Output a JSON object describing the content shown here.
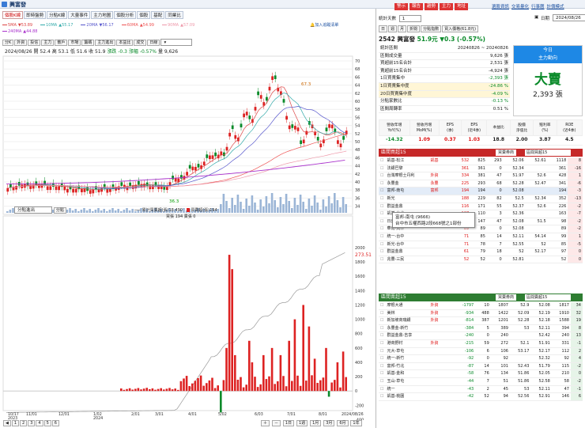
{
  "app": {
    "title": "興富發"
  },
  "top_tabs": [
    {
      "label": "個股K線",
      "active": true
    },
    {
      "label": "即時盤勢"
    },
    {
      "label": "分點K線"
    },
    {
      "label": "大量事件"
    },
    {
      "label": "主力地圖"
    },
    {
      "label": "個股分析"
    },
    {
      "label": "個股"
    },
    {
      "label": "基配"
    },
    {
      "label": "同業比"
    }
  ],
  "ma_legend": [
    {
      "label": "5MA",
      "value": "53.89",
      "dir": "▼",
      "color": "#d44"
    },
    {
      "label": "10MA",
      "value": "55.17",
      "dir": "▲",
      "color": "#3aa"
    },
    {
      "label": "20MA",
      "value": "56.17",
      "dir": "▼",
      "color": "#55c"
    },
    {
      "label": "60MA",
      "value": "54.99",
      "dir": "▲",
      "color": "#e55"
    },
    {
      "label": "90MA",
      "value": "57.09",
      "dir": "▲",
      "color": "#e9a"
    },
    {
      "label": "240MA",
      "value": "44.88",
      "dir": "▲",
      "color": "#a3c"
    }
  ],
  "mini_link": "加入追蹤清單",
  "chart_tabs": [
    "分K",
    "外資",
    "投信",
    "主力",
    "散戶",
    "市場",
    "籌碼",
    "主力進出",
    "本益比",
    "成交",
    "日線"
  ],
  "ohlc": {
    "date": "2024/08/26",
    "open": "開 52.4",
    "high": "高 53.1",
    "low": "低 51.6",
    "close": "收 51.9",
    "change": "漲跌 -0.3",
    "pct": "漲幅 -0.57%",
    "vol": "量 9,626"
  },
  "annotations": {
    "high": "67.3",
    "low": "36.3"
  },
  "price_axis": [
    "70",
    "68",
    "66",
    "64",
    "62",
    "60",
    "58",
    "56",
    "54",
    "52",
    "50",
    "48",
    "46",
    "44",
    "42",
    "40",
    "38",
    "36",
    "34"
  ],
  "lower_panel": {
    "select": "分點進出",
    "btn": "分點",
    "legend_line": "累計買賣超(張)18,490",
    "legend_bar": "買賣超(張)194",
    "legend2": "買張 194  賣張 0",
    "last_val": "273.51",
    "axis": [
      "2000",
      "1800",
      "1600",
      "1400",
      "1200",
      "1000",
      "800",
      "600",
      "400",
      "200",
      "0",
      "-200",
      "-400"
    ]
  },
  "x_dates": [
    "10/17\n2023",
    "11/01",
    "12/01",
    "1/02\n2024",
    "2/01",
    "3/01",
    "4/01",
    "5/02",
    "6/03",
    "7/01",
    "8/01",
    "2024/08/26"
  ],
  "pages": [
    "1",
    "2",
    "3",
    "4",
    "5",
    "6"
  ],
  "right_buttons": [
    "警示",
    "報告",
    "趨勢",
    "主力",
    "地址"
  ],
  "right_links": [
    "選股資訊",
    "交易量化",
    "行事曆",
    "計價模式"
  ],
  "days_label": "統計天數",
  "days_value": "1",
  "mode_buttons": [
    "日",
    "週",
    "月",
    "折閱",
    "分點指數",
    "買入價格(61.8元)"
  ],
  "date_label": "日期",
  "date_value": "2024/08/26",
  "stock": {
    "code_name": "2542 興富發",
    "price": "51.9元",
    "chg": "▼0.3 (-0.57%)"
  },
  "stats": [
    {
      "k": "統計區間",
      "v": "20240826 ~ 20240826"
    },
    {
      "k": "區間成交量",
      "v": "9,626 張"
    },
    {
      "k": "買超前15名合計",
      "v": "2,531 張"
    },
    {
      "k": "賣超前15名合計",
      "v": "-4,924 張"
    },
    {
      "k": "1日買賣集中",
      "v": "-2,393 張"
    },
    {
      "k": "1日買賣集中度",
      "v": "-24.86 %"
    },
    {
      "k": "20日買賣集中度",
      "v": "-4.09 %"
    },
    {
      "k": "分點家數比",
      "v": "-0.13 %"
    },
    {
      "k": "區間周轉率",
      "v": "0.51 %"
    }
  ],
  "main_force": {
    "label1": "今日",
    "label2": "主力動向",
    "verdict": "大賣",
    "amount": "2,393 張"
  },
  "fin_headers": [
    "營收年增\nYoY(%)",
    "營收月增\nMoM(%)",
    "EPS\n(季)",
    "EPS\n(近4季)",
    "本益比",
    "股價\n淨值比",
    "殖利率\n(%)",
    "ROE\n(近4季)"
  ],
  "fin_values": [
    "-14.32",
    "1.09",
    "0.37",
    "1.03",
    "18.8",
    "2.00",
    "3.87",
    "4.5"
  ],
  "buy_title": "區間買超15",
  "buy_sel": "買賣券商",
  "buy_rows": [
    [
      "凱基-松江",
      "凱基",
      "532",
      "825",
      "293",
      "52.06",
      "52.61",
      "1118",
      "8"
    ],
    [
      "法銀巴黎",
      "",
      "361",
      "361",
      "0",
      "52.34",
      "",
      "361",
      "-16"
    ],
    [
      "台灣摩根士丹利",
      "外資",
      "334",
      "381",
      "47",
      "51.97",
      "52.6",
      "428",
      "1"
    ],
    [
      "永豐金",
      "永豐",
      "225",
      "293",
      "68",
      "52.28",
      "52.47",
      "341",
      "-6"
    ],
    [
      "富邦-南屯",
      "富邦",
      "194",
      "194",
      "0",
      "52.08",
      "",
      "194",
      "-3"
    ],
    [
      "新光",
      "",
      "188",
      "229",
      "82",
      "52.5",
      "52.34",
      "352",
      "-13"
    ],
    [
      "群益金鼎",
      "",
      "116",
      "171",
      "55",
      "52.37",
      "52.6",
      "226",
      "-2"
    ],
    [
      "凱基-台北",
      "",
      "107",
      "110",
      "3",
      "52.36",
      "",
      "163",
      "-7"
    ],
    [
      "日盛",
      "",
      "100",
      "147",
      "47",
      "52.08",
      "51.5",
      "98",
      "-2"
    ],
    [
      "華南-員林",
      "",
      "89",
      "89",
      "0",
      "52.08",
      "",
      "89",
      "-2"
    ],
    [
      "統一-台中",
      "",
      "71",
      "85",
      "14",
      "52.11",
      "54.14",
      "99",
      "1"
    ],
    [
      "新光-台中",
      "",
      "71",
      "78",
      "7",
      "52.55",
      "52",
      "85",
      "-5"
    ],
    [
      "群益金鼎",
      "",
      "61",
      "79",
      "18",
      "52",
      "52.17",
      "97",
      "0"
    ],
    [
      "兆豐-三民",
      "",
      "52",
      "52",
      "0",
      "52.81",
      "",
      "52",
      "0"
    ]
  ],
  "tooltip": {
    "line1": "富邦-南屯 (9666)",
    "line2": "台中市五權西路2段668號之1部份"
  },
  "sell_title": "區間賣超15",
  "sell_sel": "買賣券商",
  "sell_rows": [
    [
      "摩根大通",
      "外資",
      "-1797",
      "10",
      "1807",
      "52.9",
      "52.08",
      "1817",
      "34"
    ],
    [
      "美林",
      "外資",
      "-934",
      "488",
      "1422",
      "52.09",
      "52.19",
      "1910",
      "32"
    ],
    [
      "新加坡商瑞銀",
      "外資",
      "-814",
      "387",
      "1201",
      "52.28",
      "52.18",
      "1588",
      "19"
    ],
    [
      "永豐金-新竹",
      "",
      "-384",
      "5",
      "389",
      "53",
      "52.11",
      "394",
      "8"
    ],
    [
      "群益金鼎-吉享",
      "",
      "-240",
      "0",
      "240",
      "",
      "52.42",
      "240",
      "13"
    ],
    [
      "港商野村",
      "外資",
      "-215",
      "59",
      "272",
      "52.1",
      "51.91",
      "331",
      "-1"
    ],
    [
      "元大-草屯",
      "",
      "-106",
      "6",
      "106",
      "53.17",
      "52.17",
      "112",
      "2"
    ],
    [
      "統一-新竹",
      "",
      "-92",
      "0",
      "92",
      "",
      "52.32",
      "92",
      "4"
    ],
    [
      "富邦-竹北",
      "",
      "-87",
      "14",
      "101",
      "52.43",
      "51.79",
      "115",
      "-2"
    ],
    [
      "凱基-金和",
      "",
      "-58",
      "76",
      "134",
      "51.86",
      "52.05",
      "210",
      "0"
    ],
    [
      "玉山-草屯",
      "",
      "-44",
      "7",
      "51",
      "51.86",
      "52.58",
      "58",
      "-2"
    ],
    [
      "統一",
      "",
      "-43",
      "2",
      "45",
      "53",
      "52.11",
      "47",
      "-1"
    ],
    [
      "凱基-桃園",
      "",
      "-42",
      "52",
      "94",
      "52.56",
      "52.91",
      "146",
      "6"
    ]
  ]
}
